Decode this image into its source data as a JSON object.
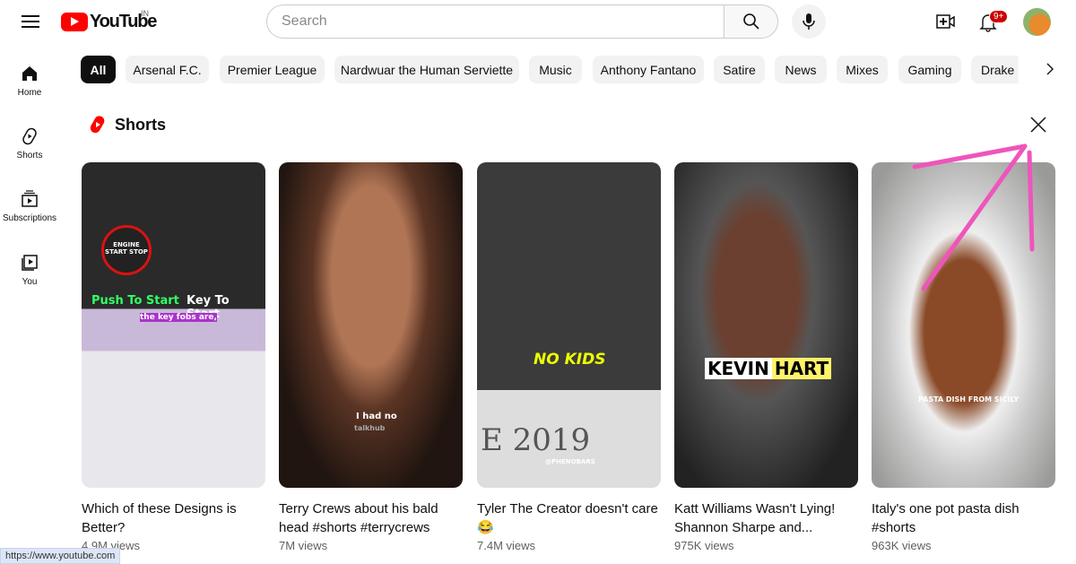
{
  "header": {
    "logo_text": "YouTube",
    "country_code": "IN",
    "search_placeholder": "Search",
    "notification_count": "9+"
  },
  "sidebar": [
    {
      "label": "Home",
      "icon": "home-icon"
    },
    {
      "label": "Shorts",
      "icon": "shorts-icon"
    },
    {
      "label": "Subscriptions",
      "icon": "subscriptions-icon"
    },
    {
      "label": "You",
      "icon": "you-icon"
    }
  ],
  "chips": [
    "All",
    "Arsenal F.C.",
    "Premier League",
    "Nardwuar the Human Serviette",
    "Music",
    "Anthony Fantano",
    "Satire",
    "News",
    "Mixes",
    "Gaming",
    "Drake"
  ],
  "shelf": {
    "title": "Shorts"
  },
  "shorts": [
    {
      "title": "Which of these Designs is Better?",
      "views": "4.9M views",
      "captions": [
        "ENGINE START STOP",
        "Push To Start",
        "Key To Start",
        "the key fobs are,"
      ]
    },
    {
      "title": "Terry Crews about his bald head #shorts #terrycrews",
      "views": "7M views",
      "captions": [
        "I had no",
        "talkhub"
      ]
    },
    {
      "title": "Tyler The Creator doesn't care 😂",
      "views": "7.4M views",
      "captions": [
        "NO KIDS",
        "E 2019",
        "@PHENOBARS"
      ]
    },
    {
      "title": "Katt Williams Wasn't Lying! Shannon Sharpe and...",
      "views": "975K views",
      "captions": [
        "KEVIN",
        "HART"
      ]
    },
    {
      "title": "Italy's one pot pasta dish #shorts",
      "views": "963K views",
      "captions": [
        "PASTA DISH FROM SICILY"
      ]
    }
  ],
  "status_url": "https://www.youtube.com"
}
